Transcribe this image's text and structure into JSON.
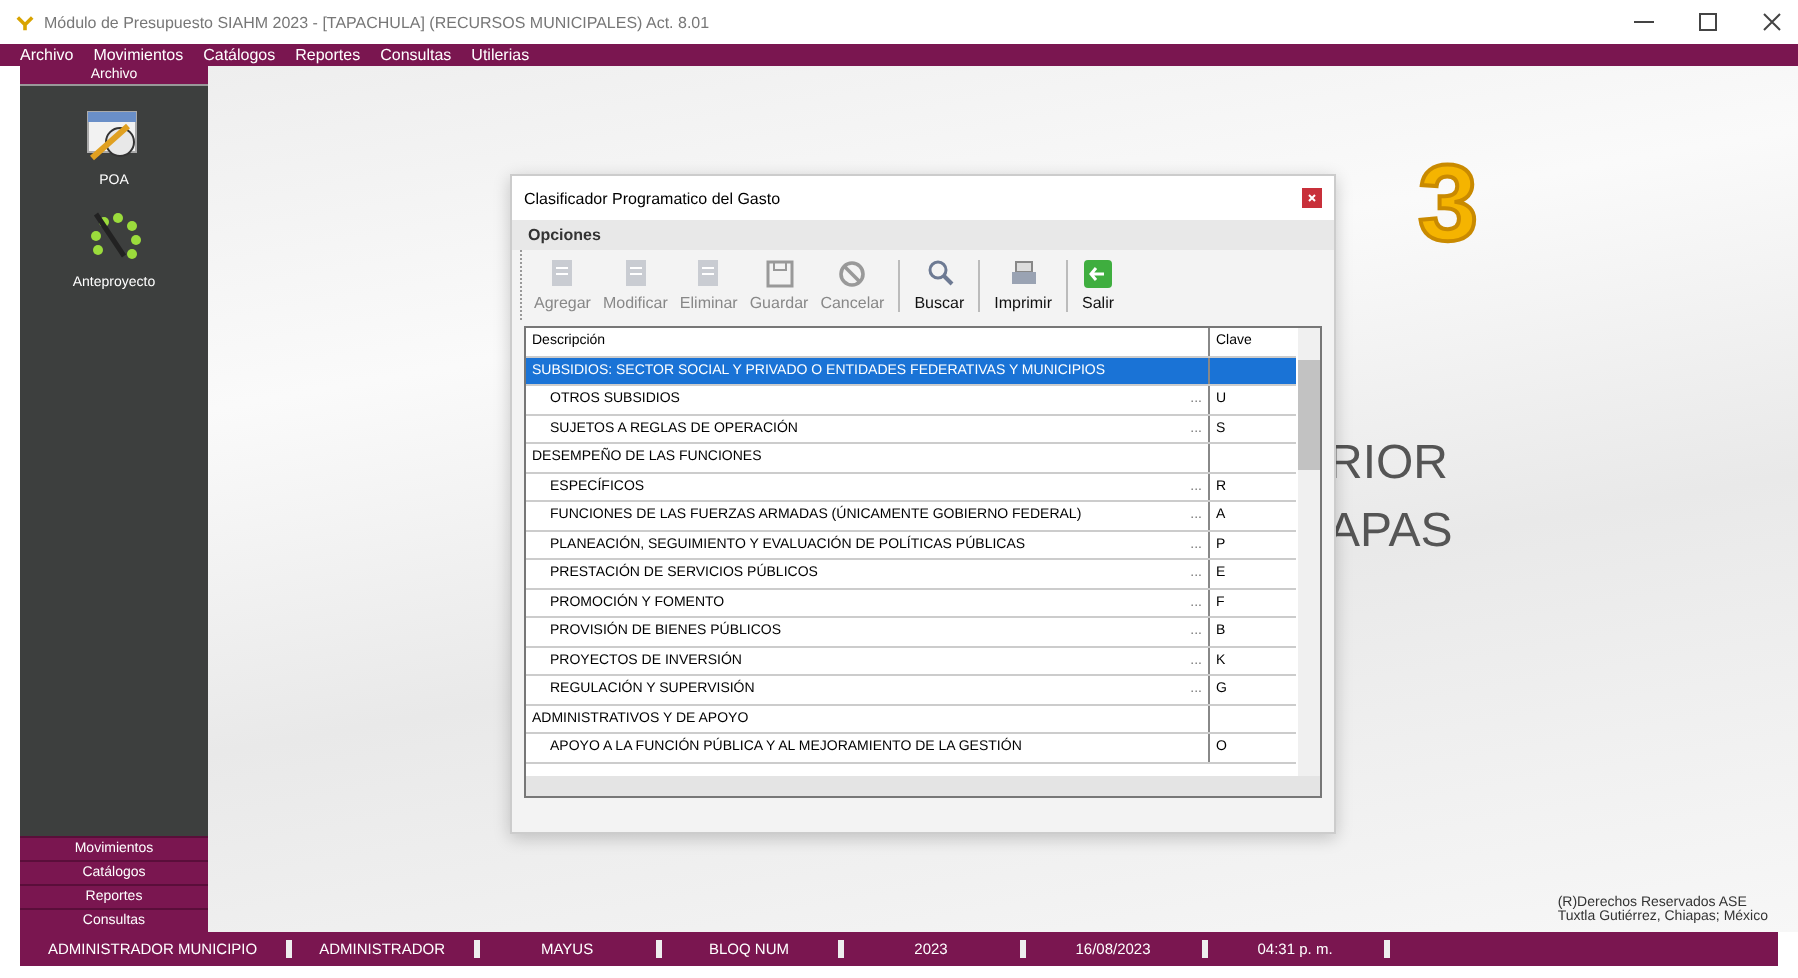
{
  "window": {
    "title": "Módulo de Presupuesto SIAHM 2023 - [TAPACHULA]   (RECURSOS MUNICIPALES)  Act. 8.01"
  },
  "menu": [
    "Archivo",
    "Movimientos",
    "Catálogos",
    "Reportes",
    "Consultas",
    "Utilerias"
  ],
  "sidebar": {
    "header": "Archivo",
    "items": [
      {
        "label": "POA",
        "kind": "calendar"
      },
      {
        "label": "Anteproyecto",
        "kind": "dots"
      }
    ],
    "sections": [
      "Movimientos",
      "Catálogos",
      "Reportes",
      "Consultas"
    ]
  },
  "background": {
    "lines": [
      "RIOR",
      "APAS"
    ],
    "footer": [
      "(R)Derechos Reservados ASE",
      "Tuxtla Gutiérrez, Chiapas; México"
    ]
  },
  "annotation": "3",
  "dialog": {
    "title": "Clasificador Programatico del Gasto",
    "menu": "Opciones",
    "toolbar": [
      {
        "label": "Agregar",
        "kind": "add",
        "disabled": true
      },
      {
        "label": "Modificar",
        "kind": "edit",
        "disabled": true
      },
      {
        "label": "Eliminar",
        "kind": "delete",
        "disabled": true
      },
      {
        "label": "Guardar",
        "kind": "save",
        "disabled": true
      },
      {
        "label": "Cancelar",
        "kind": "cancel",
        "disabled": true
      },
      {
        "label": "Buscar",
        "kind": "search",
        "disabled": false
      },
      {
        "label": "Imprimir",
        "kind": "print",
        "disabled": false
      },
      {
        "label": "Salir",
        "kind": "exit",
        "disabled": false
      }
    ],
    "columns": [
      "Descripción",
      "Clave"
    ],
    "rows": [
      {
        "kind": "group",
        "description": "SUBSIDIOS: SECTOR SOCIAL Y PRIVADO O ENTIDADES FEDERATIVAS Y MUNICIPIOS",
        "selected": true
      },
      {
        "kind": "item",
        "description": "OTROS SUBSIDIOS",
        "ellipsis": "...",
        "clave": "U",
        "selected": false
      },
      {
        "kind": "item",
        "description": "SUJETOS A REGLAS DE OPERACIÓN",
        "ellipsis": "...",
        "clave": "S",
        "selected": false
      },
      {
        "kind": "group",
        "description": "DESEMPEÑO DE LAS FUNCIONES",
        "selected": false
      },
      {
        "kind": "item",
        "description": "ESPECÍFICOS",
        "ellipsis": "...",
        "clave": "R",
        "selected": false
      },
      {
        "kind": "item",
        "description": "FUNCIONES DE LAS FUERZAS ARMADAS (ÚNICAMENTE GOBIERNO FEDERAL)",
        "ellipsis": "...",
        "clave": "A",
        "selected": false
      },
      {
        "kind": "item",
        "description": "PLANEACIÓN, SEGUIMIENTO Y EVALUACIÓN DE POLÍTICAS PÚBLICAS",
        "ellipsis": "...",
        "clave": "P",
        "selected": false
      },
      {
        "kind": "item",
        "description": "PRESTACIÓN DE SERVICIOS PÚBLICOS",
        "ellipsis": "...",
        "clave": "E",
        "selected": false
      },
      {
        "kind": "item",
        "description": "PROMOCIÓN Y FOMENTO",
        "ellipsis": "...",
        "clave": "F",
        "selected": false
      },
      {
        "kind": "item",
        "description": "PROVISIÓN DE BIENES PÚBLICOS",
        "ellipsis": "...",
        "clave": "B",
        "selected": false
      },
      {
        "kind": "item",
        "description": "PROYECTOS DE INVERSIÓN",
        "ellipsis": "...",
        "clave": "K",
        "selected": false
      },
      {
        "kind": "item",
        "description": "REGULACIÓN Y SUPERVISIÓN",
        "ellipsis": "...",
        "clave": "G",
        "selected": false
      },
      {
        "kind": "group",
        "description": "ADMINISTRATIVOS Y DE APOYO",
        "selected": false
      },
      {
        "kind": "item",
        "description": "APOYO A LA FUNCIÓN PÚBLICA Y AL MEJORAMIENTO DE LA GESTIÓN",
        "clave": "O",
        "selected": false
      }
    ]
  },
  "status_bar": [
    "ADMINISTRADOR MUNICIPIO",
    "ADMINISTRADOR",
    "MAYUS",
    "BLOQ NUM",
    "2023",
    "16/08/2023",
    "04:31 p. m."
  ]
}
